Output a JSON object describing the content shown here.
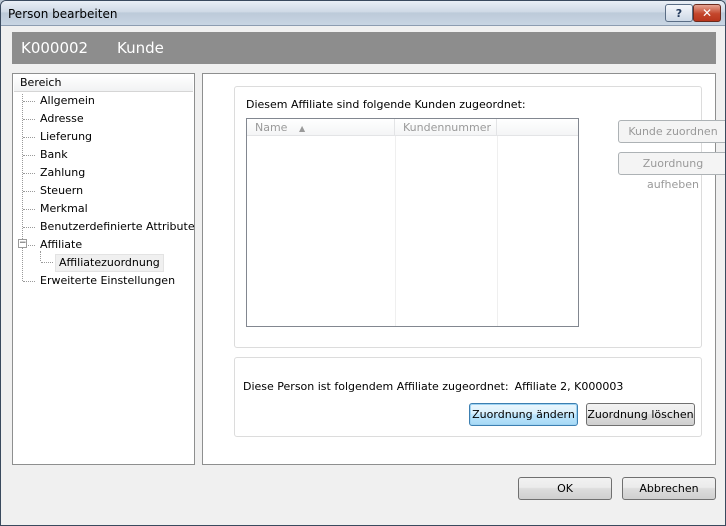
{
  "window": {
    "title": "Person bearbeiten",
    "help_label": "?",
    "close_label": "✕"
  },
  "header": {
    "id": "K000002",
    "role": "Kunde"
  },
  "tree": {
    "header": "Bereich",
    "items": [
      {
        "label": "Allgemein"
      },
      {
        "label": "Adresse"
      },
      {
        "label": "Lieferung"
      },
      {
        "label": "Bank"
      },
      {
        "label": "Zahlung"
      },
      {
        "label": "Steuern"
      },
      {
        "label": "Merkmal"
      },
      {
        "label": "Benutzerdefinierte Attribute"
      },
      {
        "label": "Affiliate",
        "expanded": true
      },
      {
        "label": "Affiliatezuordnung",
        "selected": true
      },
      {
        "label": "Erweiterte Einstellungen"
      }
    ]
  },
  "assigned_customers": {
    "caption": "Diesem Affiliate sind folgende Kunden zugeordnet:",
    "columns": [
      "Name",
      "Kundennummer"
    ],
    "sort_indicator": "▲",
    "rows": [],
    "assign_label": "Kunde zuordnen",
    "unassign_label": "Zuordnung aufheben"
  },
  "person_affiliate": {
    "text": "Diese Person ist folgendem Affiliate zugeordnet:",
    "value": "Affiliate 2, K000003",
    "change_label": "Zuordnung ändern",
    "delete_label": "Zuordnung löschen"
  },
  "footer": {
    "ok_label": "OK",
    "cancel_label": "Abbrechen"
  }
}
